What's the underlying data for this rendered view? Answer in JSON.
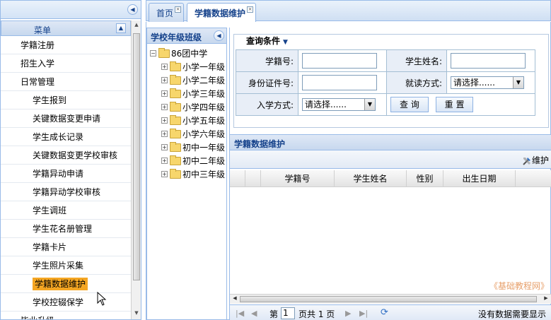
{
  "menu": {
    "header": "菜单",
    "items": [
      {
        "label": "学籍注册",
        "level": 1
      },
      {
        "label": "招生入学",
        "level": 1
      },
      {
        "label": "日常管理",
        "level": 1
      },
      {
        "label": "学生报到",
        "level": 2
      },
      {
        "label": "关键数据变更申请",
        "level": 2
      },
      {
        "label": "学生成长记录",
        "level": 2
      },
      {
        "label": "关键数据变更学校审核",
        "level": 2
      },
      {
        "label": "学籍异动申请",
        "level": 2
      },
      {
        "label": "学籍异动学校审核",
        "level": 2
      },
      {
        "label": "学生调班",
        "level": 2
      },
      {
        "label": "学生花名册管理",
        "level": 2
      },
      {
        "label": "学籍卡片",
        "level": 2
      },
      {
        "label": "学生照片采集",
        "level": 2
      },
      {
        "label": "学籍数据维护",
        "level": 2,
        "active": true
      },
      {
        "label": "学校控辍保学",
        "level": 2
      },
      {
        "label": "毕业升级",
        "level": 1
      }
    ]
  },
  "tabs": [
    {
      "label": "首页",
      "active": false
    },
    {
      "label": "学籍数据维护",
      "active": true
    }
  ],
  "tree": {
    "title": "学校年级班级",
    "root": "86团中学",
    "children": [
      "小学一年级",
      "小学二年级",
      "小学三年级",
      "小学四年级",
      "小学五年级",
      "小学六年级",
      "初中一年级",
      "初中二年级",
      "初中三年级"
    ]
  },
  "query": {
    "title": "查询条件",
    "student_no_label": "学籍号:",
    "student_name_label": "学生姓名:",
    "id_card_label": "身份证件号:",
    "study_mode_label": "就读方式:",
    "study_mode_value": "请选择......",
    "enroll_mode_label": "入学方式:",
    "enroll_mode_value": "请选择......",
    "search_button": "查 询",
    "reset_button": "重 置"
  },
  "grid": {
    "title": "学籍数据维护",
    "maintain_label": "维护",
    "columns": [
      "学籍号",
      "学生姓名",
      "性别",
      "出生日期"
    ],
    "pager": {
      "page_prefix": "第",
      "page_value": "1",
      "page_suffix": "页共 1 页",
      "empty_message": "没有数据需要显示"
    }
  },
  "watermark": "《基础教程网》",
  "colors": {
    "accent": "#15428b",
    "active_menu": "#f5a623",
    "border": "#99bbe8"
  }
}
